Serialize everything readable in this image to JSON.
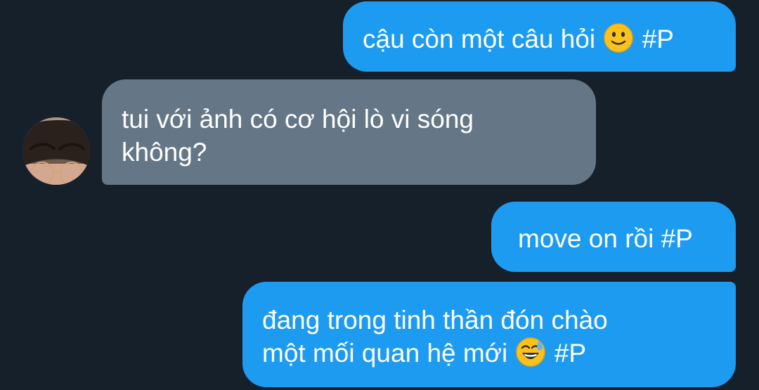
{
  "conversation": {
    "messages": [
      {
        "sender": "me",
        "text": "cậu còn một câu hỏi",
        "emoji": "slightly-smiling-face",
        "tag": "#P"
      },
      {
        "sender": "other",
        "lines": [
          "tui với ảnh có cơ hội lò vi sóng",
          "không?"
        ]
      },
      {
        "sender": "me",
        "text": "move on rồi #P"
      },
      {
        "sender": "me",
        "lines": [
          "đang trong tinh thần đón chào",
          "một mối quan hệ mới"
        ],
        "emoji": "grinning-face-with-sweat",
        "tag": "#P"
      }
    ]
  },
  "colors": {
    "background": "#15202b",
    "outgoing_bubble": "#1d9bf0",
    "incoming_bubble": "#657786",
    "text": "#ffffff"
  }
}
